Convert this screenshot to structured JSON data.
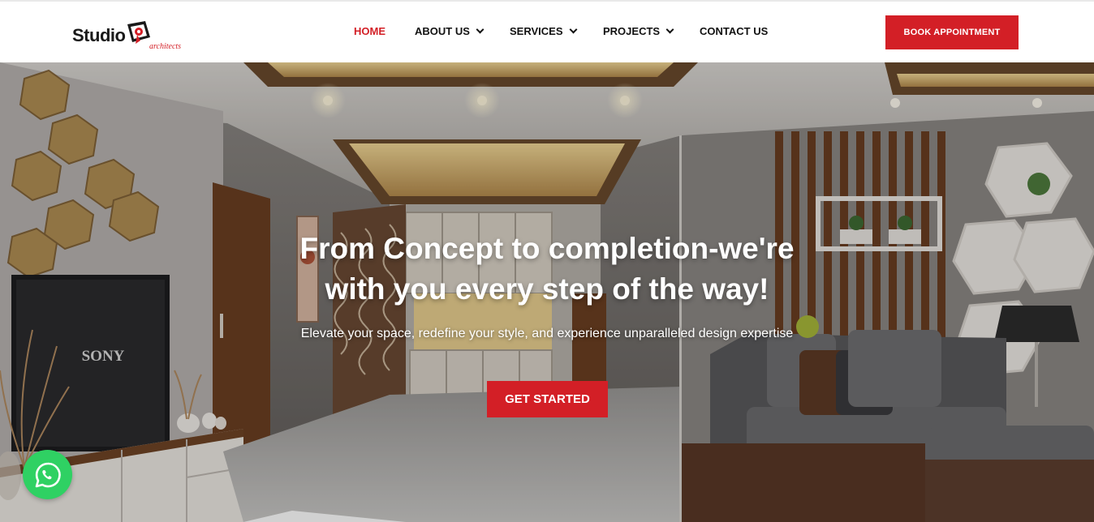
{
  "brand": {
    "name": "Studio",
    "tagline": "architects",
    "accent_color": "#d31f26"
  },
  "nav": {
    "items": [
      {
        "label": "HOME",
        "active": true,
        "has_dropdown": false
      },
      {
        "label": "ABOUT US",
        "active": false,
        "has_dropdown": true
      },
      {
        "label": "SERVICES",
        "active": false,
        "has_dropdown": true
      },
      {
        "label": "PROJECTS",
        "active": false,
        "has_dropdown": true
      },
      {
        "label": "CONTACT US",
        "active": false,
        "has_dropdown": false
      }
    ],
    "dropdown_icon": "chevron-down-icon"
  },
  "header": {
    "book_label": "BOOK APPOINTMENT"
  },
  "hero": {
    "title_line1": "From Concept to completion-we're",
    "title_line2": "with you every step of the way!",
    "subtitle": "Elevate your space, redefine your style, and experience unparalleled design expertise",
    "cta_label": "GET STARTED",
    "tv_brand": "SONY"
  },
  "floating": {
    "whatsapp_icon": "whatsapp-icon",
    "whatsapp_color": "#2fd163"
  }
}
